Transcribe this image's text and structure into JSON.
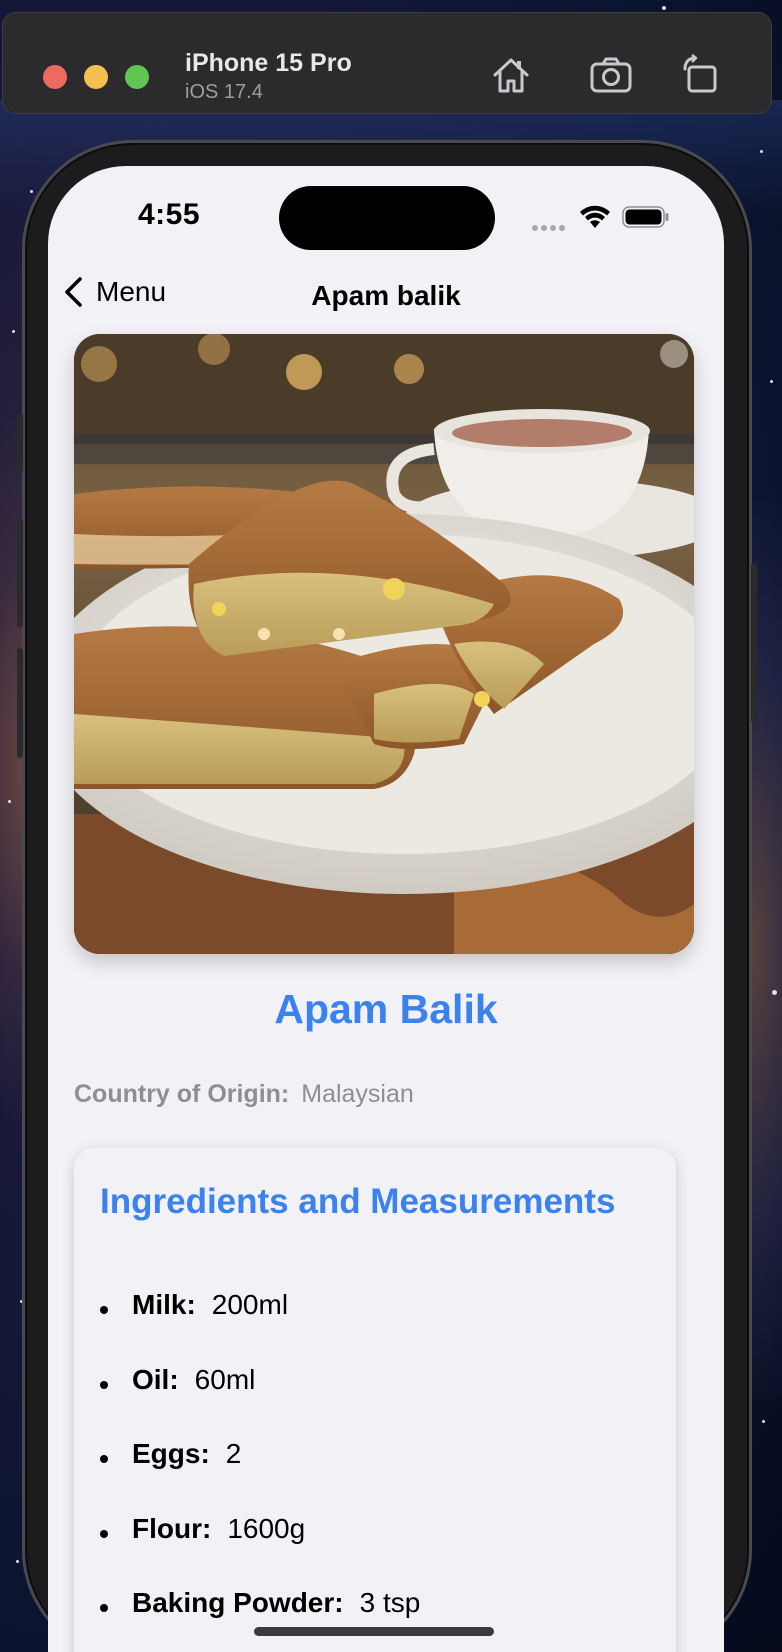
{
  "simulator": {
    "device_name": "iPhone 15 Pro",
    "os_version": "iOS 17.4",
    "toolbar_icons": [
      "home-icon",
      "screenshot-icon",
      "rotate-icon"
    ]
  },
  "status_bar": {
    "time": "4:55",
    "icons": [
      "cellular-icon",
      "wifi-icon",
      "battery-icon"
    ]
  },
  "nav": {
    "back_label": "Menu",
    "title": "Apam balik"
  },
  "recipe": {
    "title": "Apam Balik",
    "origin_label": "Country of Origin:",
    "origin_value": "Malaysian",
    "ingredients_heading": "Ingredients and Measurements",
    "ingredients": [
      {
        "name": "Milk:",
        "measure": "200ml"
      },
      {
        "name": "Oil:",
        "measure": "60ml"
      },
      {
        "name": "Eggs:",
        "measure": "2"
      },
      {
        "name": "Flour:",
        "measure": "1600g"
      },
      {
        "name": "Baking Powder:",
        "measure": "3 tsp"
      }
    ]
  },
  "colors": {
    "accent": "#3a82f0",
    "screen_bg": "#f1f1f6",
    "secondary_text": "#8e8e93"
  }
}
